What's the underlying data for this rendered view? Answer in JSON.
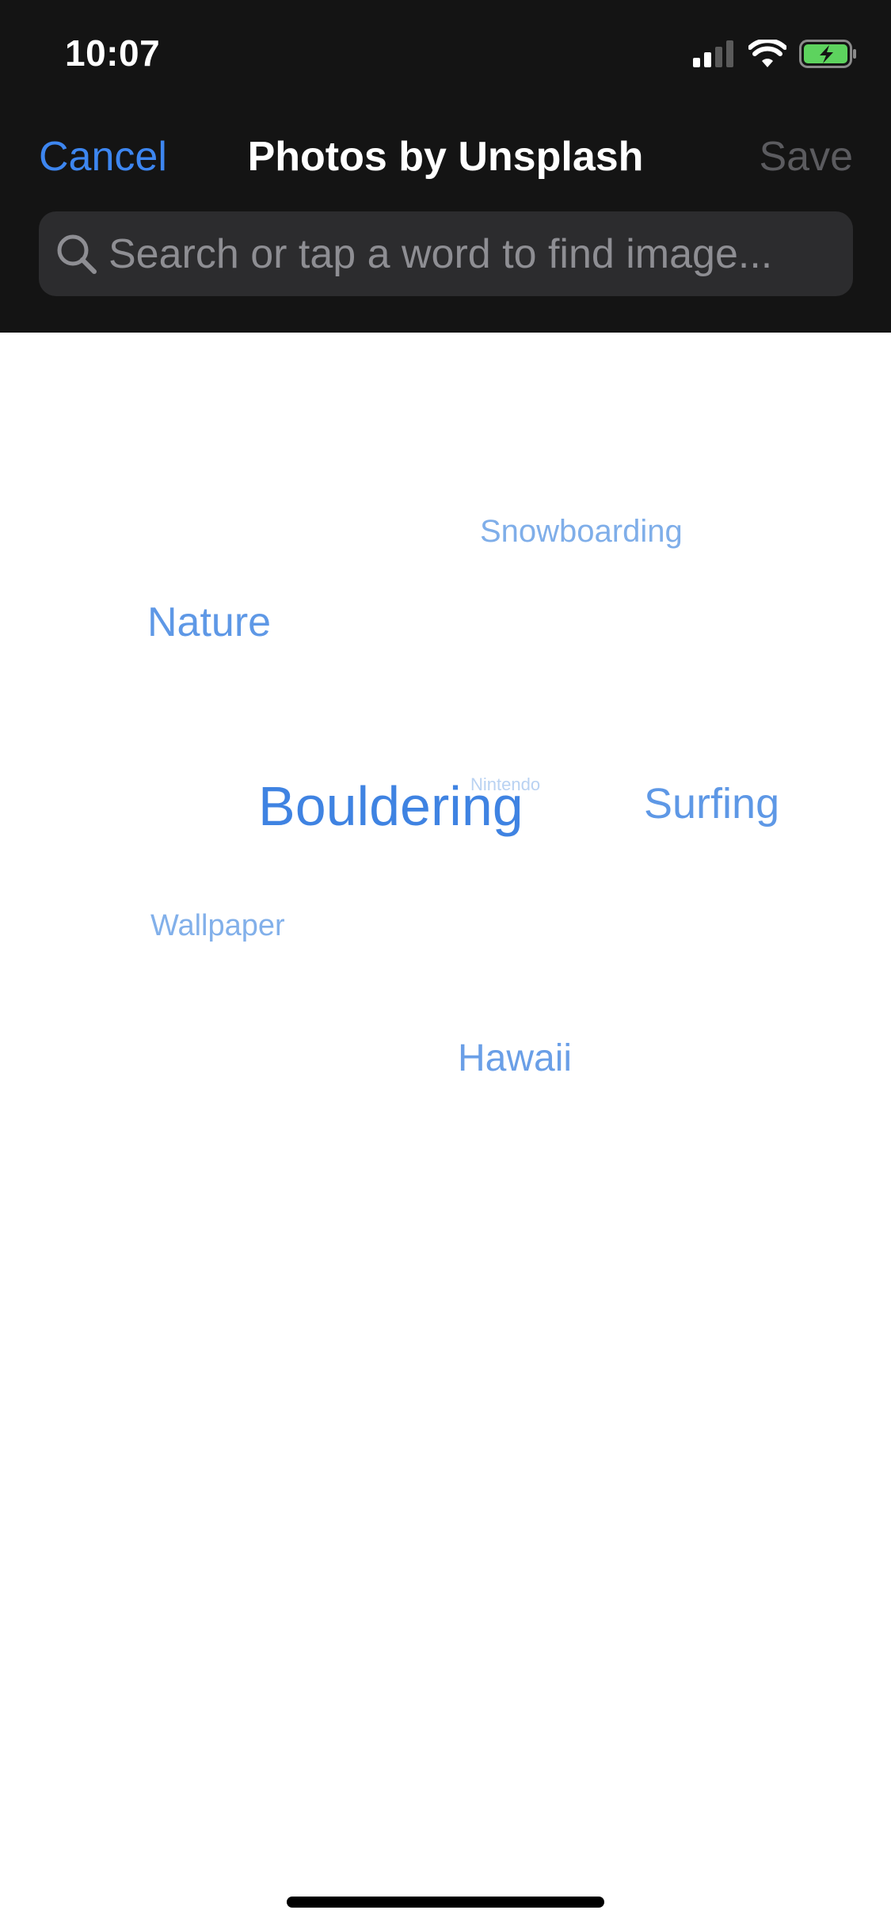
{
  "status_bar": {
    "time": "10:07",
    "icons": [
      "cellular-signal-icon",
      "wifi-icon",
      "battery-charging-icon"
    ],
    "battery_color": "#5dd35e"
  },
  "nav": {
    "cancel_label": "Cancel",
    "title": "Photos by Unsplash",
    "save_label": "Save"
  },
  "search": {
    "placeholder": "Search or tap a word to find image...",
    "value": ""
  },
  "word_cloud": {
    "words": [
      {
        "text": "Snowboarding"
      },
      {
        "text": "Nature"
      },
      {
        "text": "Bouldering"
      },
      {
        "text": "Nintendo"
      },
      {
        "text": "Surfing"
      },
      {
        "text": "Wallpaper"
      },
      {
        "text": "Hawaii"
      }
    ]
  },
  "colors": {
    "header_background": "#141414",
    "accent": "#3d86f0",
    "disabled": "#5b5b5f",
    "search_field": "#2c2c2e"
  }
}
